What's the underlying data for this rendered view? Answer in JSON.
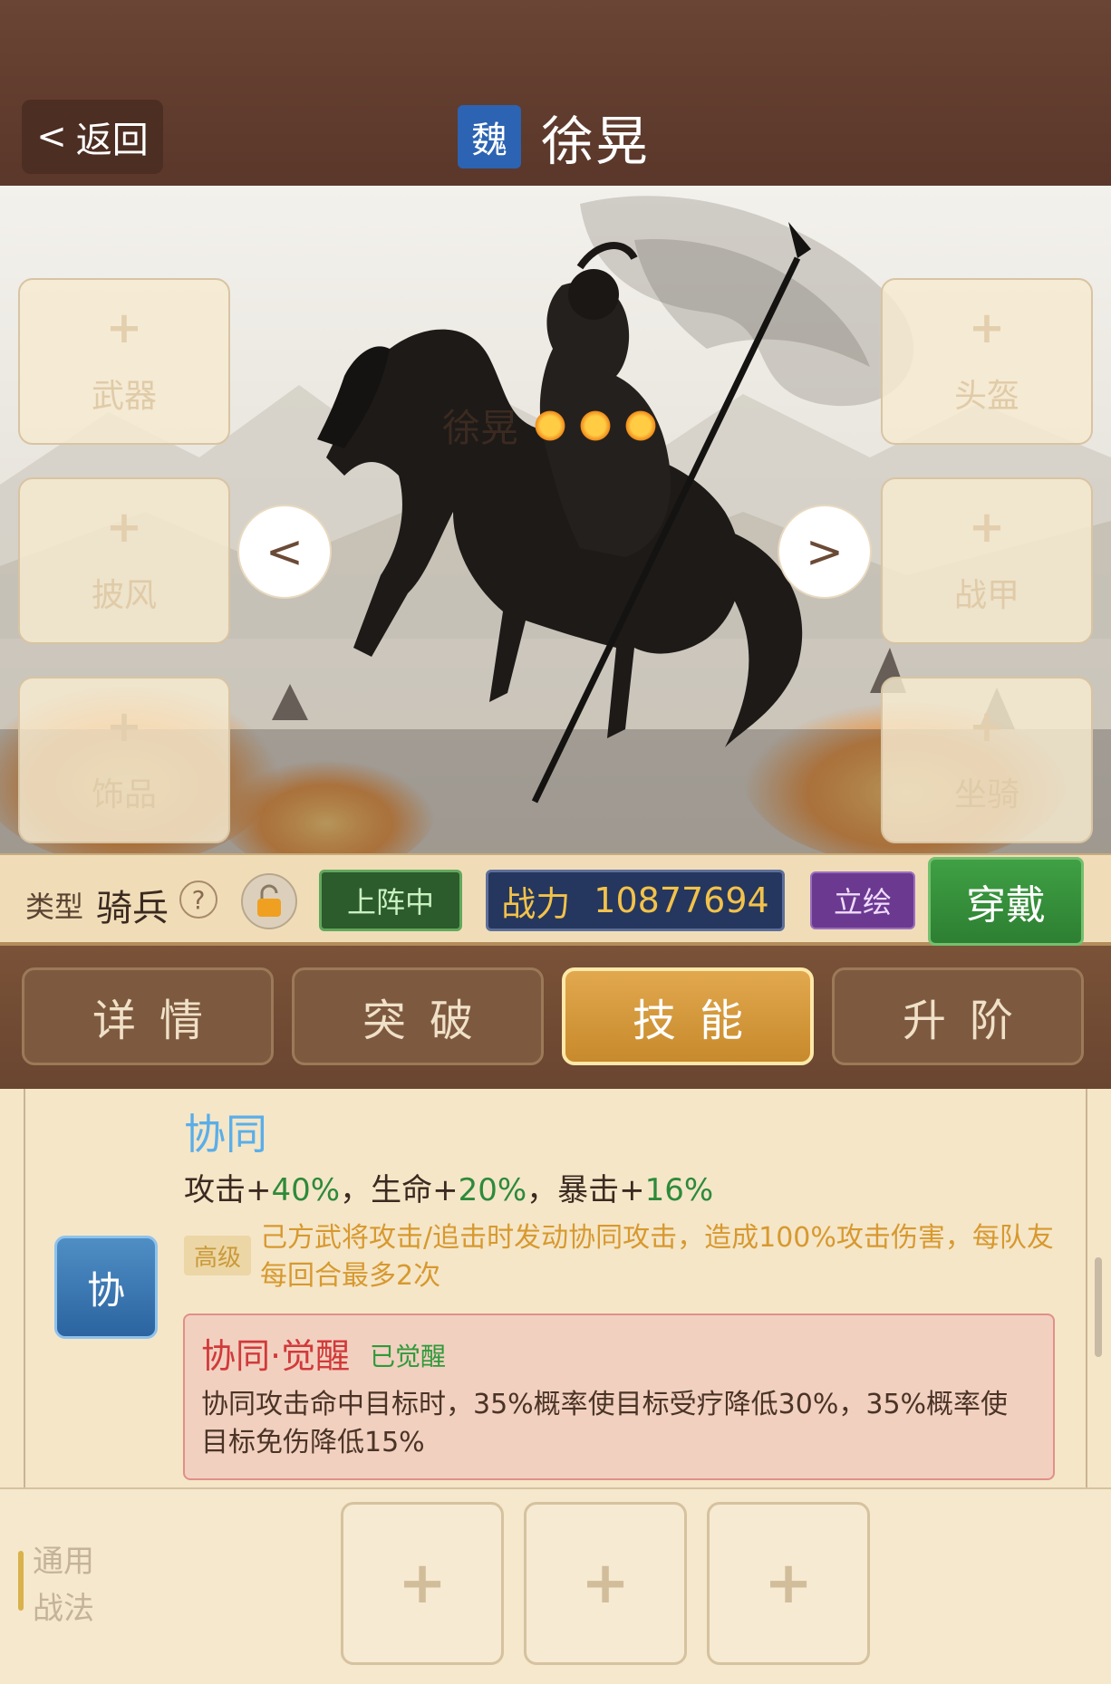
{
  "header": {
    "back_label": "返回",
    "faction": "魏",
    "hero_title": "徐晃"
  },
  "portrait": {
    "hero_name": "徐晃",
    "star_count": 3,
    "equipment_slots": {
      "weapon": {
        "plus": "+",
        "label": "武器"
      },
      "cloak": {
        "plus": "+",
        "label": "披风"
      },
      "accessory": {
        "plus": "+",
        "label": "饰品"
      },
      "helmet": {
        "plus": "+",
        "label": "头盔"
      },
      "armor": {
        "plus": "+",
        "label": "战甲"
      },
      "mount": {
        "plus": "+",
        "label": "坐骑"
      }
    },
    "prev_arrow": "<",
    "next_arrow": ">"
  },
  "info_bar": {
    "type_label": "类型",
    "type_value": "骑兵",
    "help": "?",
    "deployed": "上阵中",
    "power_label": "战力",
    "power_value": "10877694",
    "portrait_button": "立绘",
    "equip_button": "穿戴"
  },
  "tabs": [
    {
      "label": "详情",
      "active": false
    },
    {
      "label": "突破",
      "active": false
    },
    {
      "label": "技能",
      "active": true
    },
    {
      "label": "升阶",
      "active": false
    }
  ],
  "skill": {
    "icon_char": "协",
    "name": "协同",
    "stats": {
      "atk_label": "攻击+",
      "atk_value": "40%",
      "hp_label": "，生命+",
      "hp_value": "20%",
      "crit_label": "，暴击+",
      "crit_value": "16%"
    },
    "tier": "高级",
    "description": "己方武将攻击/追击时发动协同攻击，造成100%攻击伤害，每队友每回合最多2次",
    "awaken": {
      "title": "协同·觉醒",
      "tag": "已觉醒",
      "description": "协同攻击命中目标时，35%概率使目标受疗降低30%，35%概率使目标免伤降低15%"
    }
  },
  "general_tactics": {
    "label": "通用战法",
    "slots": [
      "+",
      "+",
      "+"
    ]
  },
  "colors": {
    "header_bg": "#5a372a",
    "faction_blue": "#2c63b2",
    "deployed_green": "#2c5b2c",
    "power_navy": "#25375e",
    "portrait_purple": "#6b3a90",
    "equip_green": "#3fa044",
    "active_tab_gold": "#d99a3a",
    "skill_name_blue": "#5aaee8",
    "awaken_red": "#d13a3a"
  }
}
